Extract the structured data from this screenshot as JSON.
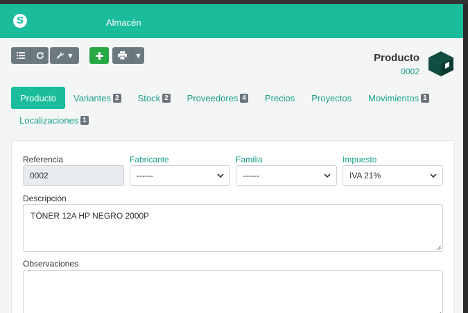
{
  "navbar": {
    "logo": "S",
    "app_name": "Almacén",
    "color": "#1abc9c"
  },
  "toolbar": {
    "list_icon": "list-icon",
    "refresh_icon": "refresh-icon",
    "tools_icon": "wrench-icon",
    "new_icon": "plus-icon",
    "print_icon": "printer-icon"
  },
  "header": {
    "title": "Producto",
    "code": "0002",
    "icon": "box-icon"
  },
  "tabs": [
    {
      "label": "Producto",
      "badge": ""
    },
    {
      "label": "Variantes",
      "badge": "2"
    },
    {
      "label": "Stock",
      "badge": "2"
    },
    {
      "label": "Proveedores",
      "badge": "4"
    },
    {
      "label": "Precios",
      "badge": ""
    },
    {
      "label": "Proyectos",
      "badge": ""
    },
    {
      "label": "Movimientos",
      "badge": "1"
    },
    {
      "label": "Localizaciones",
      "badge": "1"
    }
  ],
  "form": {
    "referencia": {
      "label": "Referencia",
      "value": "0002"
    },
    "fabricante": {
      "label": "Fabricante",
      "value": "------"
    },
    "familia": {
      "label": "Familia",
      "value": "------"
    },
    "impuesto": {
      "label": "Impuesto",
      "value": "IVA 21%"
    },
    "descripcion": {
      "label": "Descripción",
      "value": "TÓNER 12A HP NEGRO 2000P"
    },
    "observaciones": {
      "label": "Observaciones",
      "value": ""
    }
  }
}
